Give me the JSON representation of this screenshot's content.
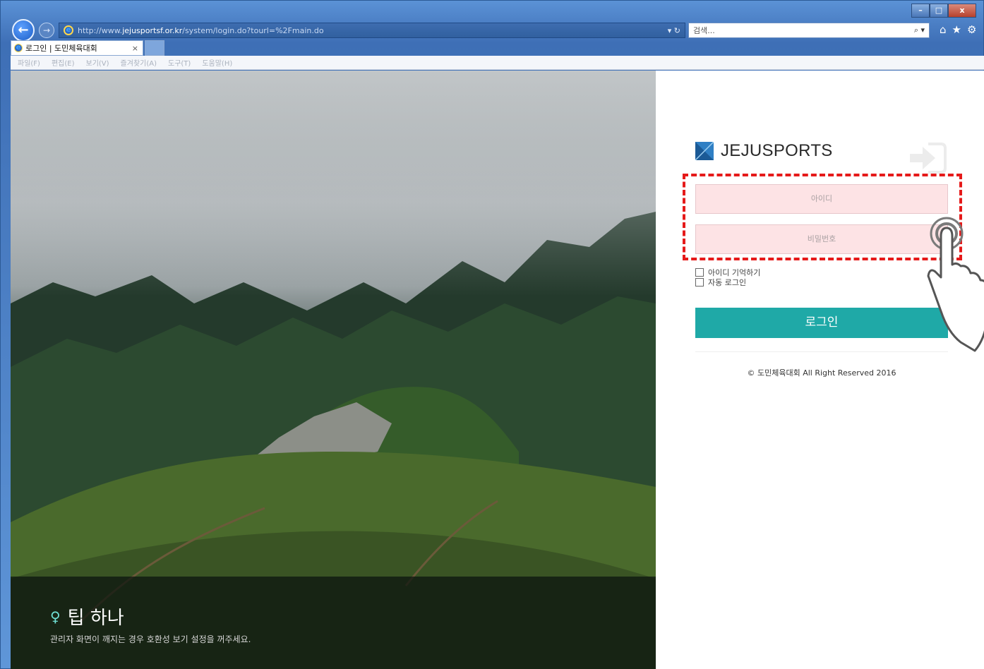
{
  "browser": {
    "url_prefix": "http://www.",
    "url_domain": "jejusportsf.or.kr",
    "url_path": "/system/login.do?tourl=%2Fmain.do",
    "search_placeholder": "검색...",
    "tab_title": "로그인 | 도민체육대회",
    "tab_close": "×",
    "address_tools": "▾ ↻",
    "search_tools": "⌕ ▾",
    "caption": {
      "minimize": "–",
      "maximize": "□",
      "close": "x"
    },
    "toolbar_icons": [
      "home-icon",
      "favorites-star-icon",
      "settings-gear-icon"
    ],
    "menu": [
      "파일(F)",
      "편집(E)",
      "보기(V)",
      "즐겨찾기(A)",
      "도구(T)",
      "도움말(H)"
    ]
  },
  "hero": {
    "tip_title": "팁 하나",
    "tip_text": "관리자 화면이 깨지는 경우 호환성 보기 설정을 꺼주세요."
  },
  "login": {
    "logo_text": "JEJUSPORTS",
    "id_placeholder": "아이디",
    "pw_placeholder": "비밀번호",
    "remember_id": "아이디 기억하기",
    "auto_login": "자동 로그인",
    "login_button": "로그인",
    "copyright": "© 도민체육대회 All Right Reserved 2016"
  },
  "colors": {
    "accent": "#1fa9a7",
    "highlight": "#e51a1a",
    "field_bg": "#fde3e5"
  }
}
